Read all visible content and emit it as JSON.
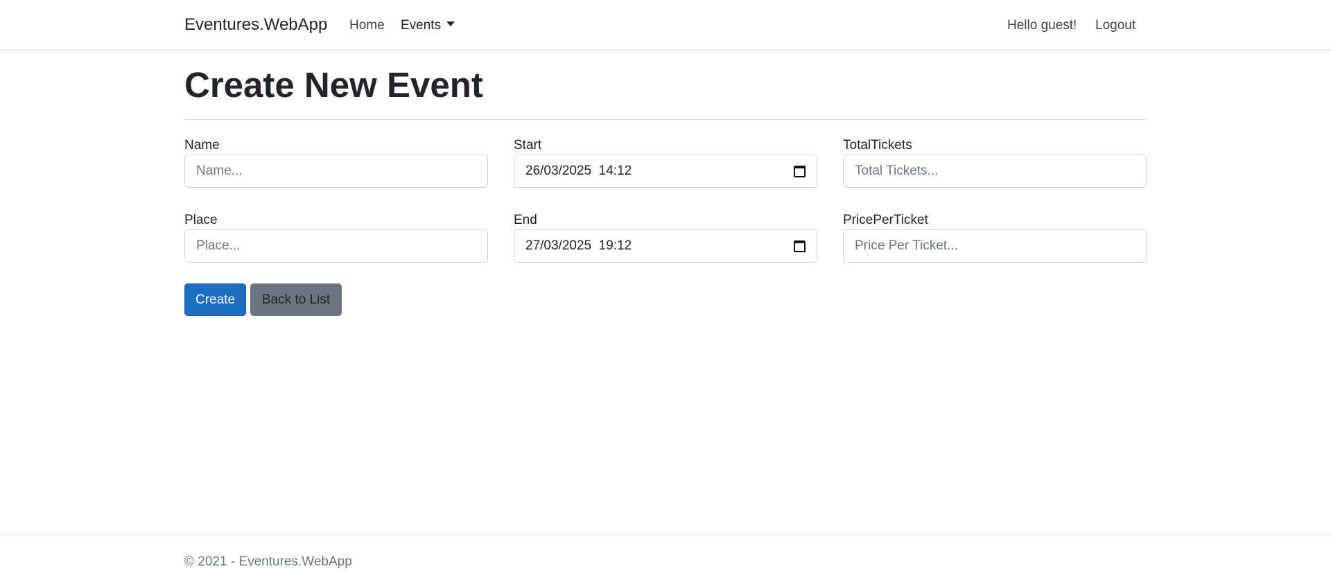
{
  "navbar": {
    "brand": "Eventures.WebApp",
    "home": "Home",
    "events": "Events",
    "greeting": "Hello guest!",
    "logout": "Logout"
  },
  "page": {
    "title": "Create New Event"
  },
  "form": {
    "name": {
      "label": "Name",
      "placeholder": "Name..."
    },
    "place": {
      "label": "Place",
      "placeholder": "Place..."
    },
    "start": {
      "label": "Start",
      "value": "26/03/2025  14:12"
    },
    "end": {
      "label": "End",
      "value": "27/03/2025  19:12"
    },
    "total_tickets": {
      "label": "TotalTickets",
      "placeholder": "Total Tickets..."
    },
    "price_per_ticket": {
      "label": "PricePerTicket",
      "placeholder": "Price Per Ticket..."
    },
    "create_label": "Create",
    "back_label": "Back to List"
  },
  "footer": {
    "text": "© 2021 - Eventures.WebApp"
  },
  "colors": {
    "primary": "#1b6ec2",
    "secondary": "#6c757d",
    "text": "#212529",
    "muted": "#6c757d"
  }
}
